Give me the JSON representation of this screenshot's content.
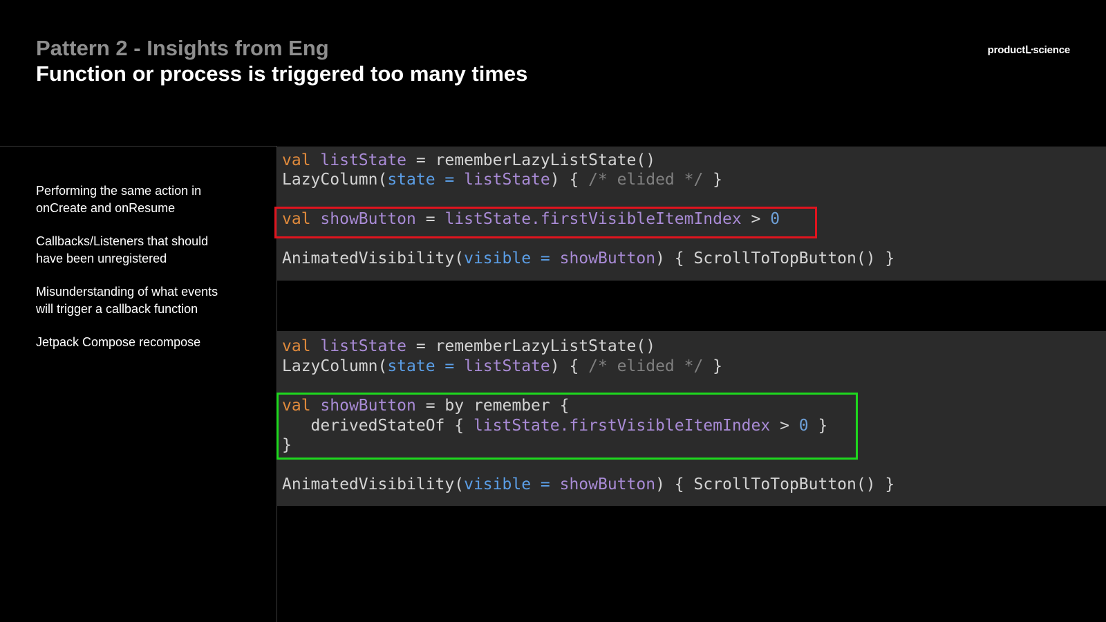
{
  "header": {
    "subtitle": "Pattern 2 - Insights from Eng",
    "title": "Function or process is triggered too many times",
    "logo_left": "product",
    "logo_right": "science"
  },
  "bullets": [
    "Performing the same action in onCreate and onResume",
    "Callbacks/Listeners that should have been unregistered",
    "Misunderstanding of what events will trigger a callback function",
    "Jetpack Compose recompose"
  ],
  "code": {
    "top": {
      "l1": {
        "kw": "val",
        "var": "listState",
        "rest": " = rememberLazyListState()"
      },
      "l2": {
        "fn": "LazyColumn(",
        "param": "state =",
        "var": "listState",
        "rest": ") { ",
        "cmt": "/* elided */",
        "end": " }"
      },
      "l3": {
        "kw": "val",
        "var": "showButton",
        "eq": " = ",
        "var2": "listState.firstVisibleItemIndex",
        "gt": " > ",
        "num": "0"
      },
      "l4": {
        "fn": "AnimatedVisibility(",
        "param": "visible =",
        "var": "showButton",
        "rest": ") { ScrollToTopButton() }"
      }
    },
    "bottom": {
      "l1": {
        "kw": "val",
        "var": "listState",
        "rest": " = rememberLazyListState()"
      },
      "l2": {
        "fn": "LazyColumn(",
        "param": "state =",
        "var": "listState",
        "rest": ") { ",
        "cmt": "/* elided */",
        "end": " }"
      },
      "l3": {
        "kw": "val",
        "var": "showButton",
        "rest": " = by remember {"
      },
      "l4": {
        "fn": "   derivedStateOf { ",
        "var": "listState.firstVisibleItemIndex",
        "gt": " > ",
        "num": "0",
        "end": " }"
      },
      "l5": {
        "text": "}"
      },
      "l6": {
        "fn": "AnimatedVisibility(",
        "param": "visible =",
        "var": "showButton",
        "rest": ") { ScrollToTopButton() }"
      }
    }
  },
  "colors": {
    "keyword": "#e08a3c",
    "variable": "#a98bd6",
    "parameter": "#5b9ee6",
    "comment": "#808080",
    "highlight_bad": "#e0141e",
    "highlight_good": "#1ed81e"
  }
}
